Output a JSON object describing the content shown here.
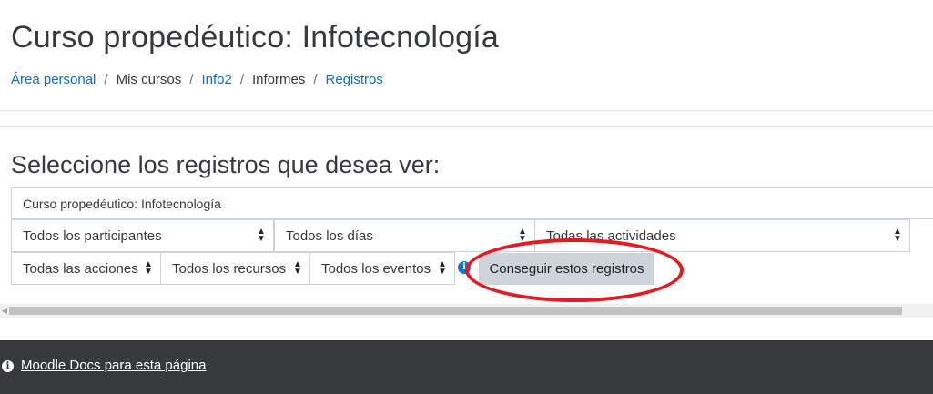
{
  "header": {
    "title": "Curso propedéutico: Infotecnología"
  },
  "breadcrumb": {
    "items": [
      {
        "label": "Área personal",
        "link": true
      },
      {
        "label": "Mis cursos",
        "link": false
      },
      {
        "label": "Info2",
        "link": true
      },
      {
        "label": "Informes",
        "link": false
      },
      {
        "label": "Registros",
        "link": true
      }
    ],
    "separator": "/"
  },
  "form": {
    "heading": "Seleccione los registros que desea ver:",
    "course_value": "Curso propedéutico: Infotecnología",
    "participants_select": "Todos los participantes",
    "days_select": "Todos los días",
    "activities_select": "Todas las actividades",
    "actions_select": "Todas las acciones",
    "resources_select": "Todos los recursos",
    "events_select": "Todos los eventos",
    "submit_label": "Conseguir estos registros"
  },
  "annotation": {
    "color": "#e41b23",
    "shape": "ellipse around submit button"
  },
  "footer": {
    "docs_link": "Moodle Docs para esta página",
    "icon": "info-icon"
  },
  "colors": {
    "link": "#0f6fc5",
    "footer_bg": "#373a3c",
    "button_bg": "#ced4da"
  }
}
